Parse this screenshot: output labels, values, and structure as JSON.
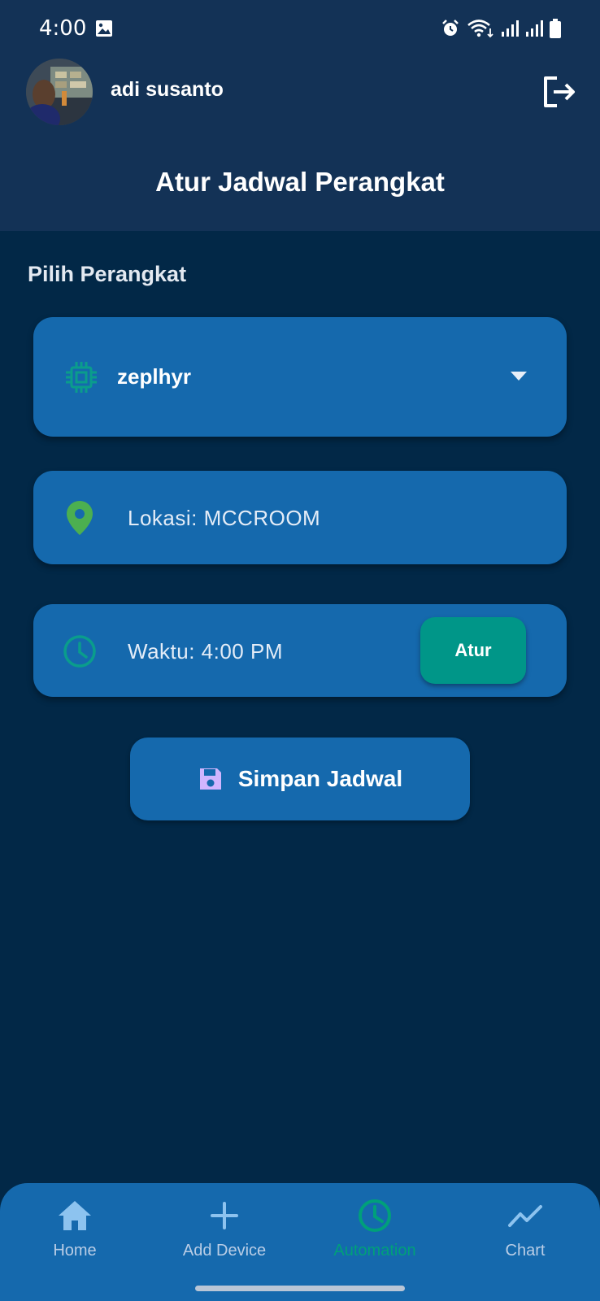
{
  "status_bar": {
    "time": "4:00",
    "icons": [
      "image-icon",
      "alarm-icon",
      "wifi-icon",
      "signal-icon",
      "signal-icon",
      "battery-icon"
    ]
  },
  "header": {
    "user_name": "adi susanto",
    "page_title": "Atur Jadwal Perangkat",
    "logout_icon": "logout-icon"
  },
  "form": {
    "section_label": "Pilih Perangkat",
    "device": {
      "icon": "chip-icon",
      "selected_value": "zeplhyr"
    },
    "location": {
      "icon": "location-pin-icon",
      "text": "Lokasi: MCCROOM"
    },
    "time": {
      "icon": "clock-icon",
      "text": "Waktu: 4:00 PM",
      "button_label": "Atur"
    },
    "save_button": {
      "icon": "floppy-disk-icon",
      "label": "Simpan Jadwal"
    }
  },
  "bottom_nav": {
    "items": [
      {
        "label": "Home",
        "icon": "home-icon",
        "active": false
      },
      {
        "label": "Add Device",
        "icon": "plus-icon",
        "active": false
      },
      {
        "label": "Automation",
        "icon": "clock-icon",
        "active": true
      },
      {
        "label": "Chart",
        "icon": "trend-line-icon",
        "active": false
      }
    ]
  },
  "colors": {
    "background": "#022847",
    "app_bar": "#133256",
    "card": "#1569ad",
    "accent_teal": "#009688",
    "active_nav": "#00a07a",
    "location_icon": "#4caf50",
    "save_icon": "#d1b6ff"
  }
}
